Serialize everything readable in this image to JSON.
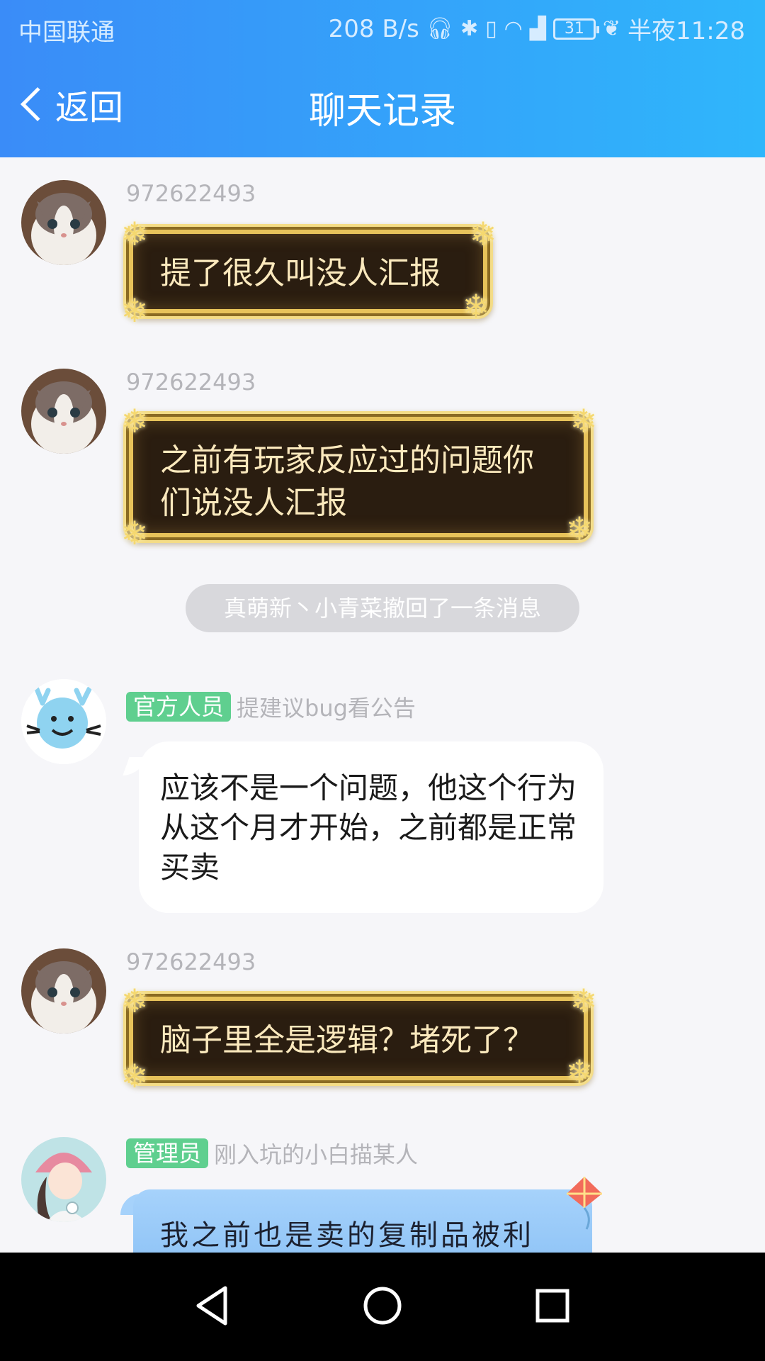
{
  "status_bar": {
    "carrier": "中国联通",
    "speed": "208 B/s",
    "battery": "31",
    "time": "半夜11:28"
  },
  "header": {
    "back_label": "返回",
    "title": "聊天记录"
  },
  "messages": [
    {
      "sender": "972622493",
      "text": "提了很久叫没人汇报"
    },
    {
      "sender": "972622493",
      "text": "之前有玩家反应过的问题你们说没人汇报"
    },
    {
      "sender_tag": "官方人员",
      "sender": "提建议bug看公告",
      "text": "应该不是一个问题，他这个行为从这个月才开始，之前都是正常买卖"
    },
    {
      "sender": "972622493",
      "text": "脑子里全是逻辑？堵死了？"
    },
    {
      "sender_tag": "管理员",
      "sender": "刚入坑的小白描某人",
      "text": "我之前也是卖的复制品被利"
    }
  ],
  "recall_notice": "真萌新丶小青菜撤回了一条消息",
  "colors": {
    "header_start": "#3a8cf8",
    "header_end": "#2fb6fb",
    "tag_green": "#5fcf8f",
    "gold": "#e8c35a"
  },
  "icons": {
    "nav_back": "triangle-back-icon",
    "nav_home": "circle-home-icon",
    "nav_recent": "square-recent-icon"
  }
}
